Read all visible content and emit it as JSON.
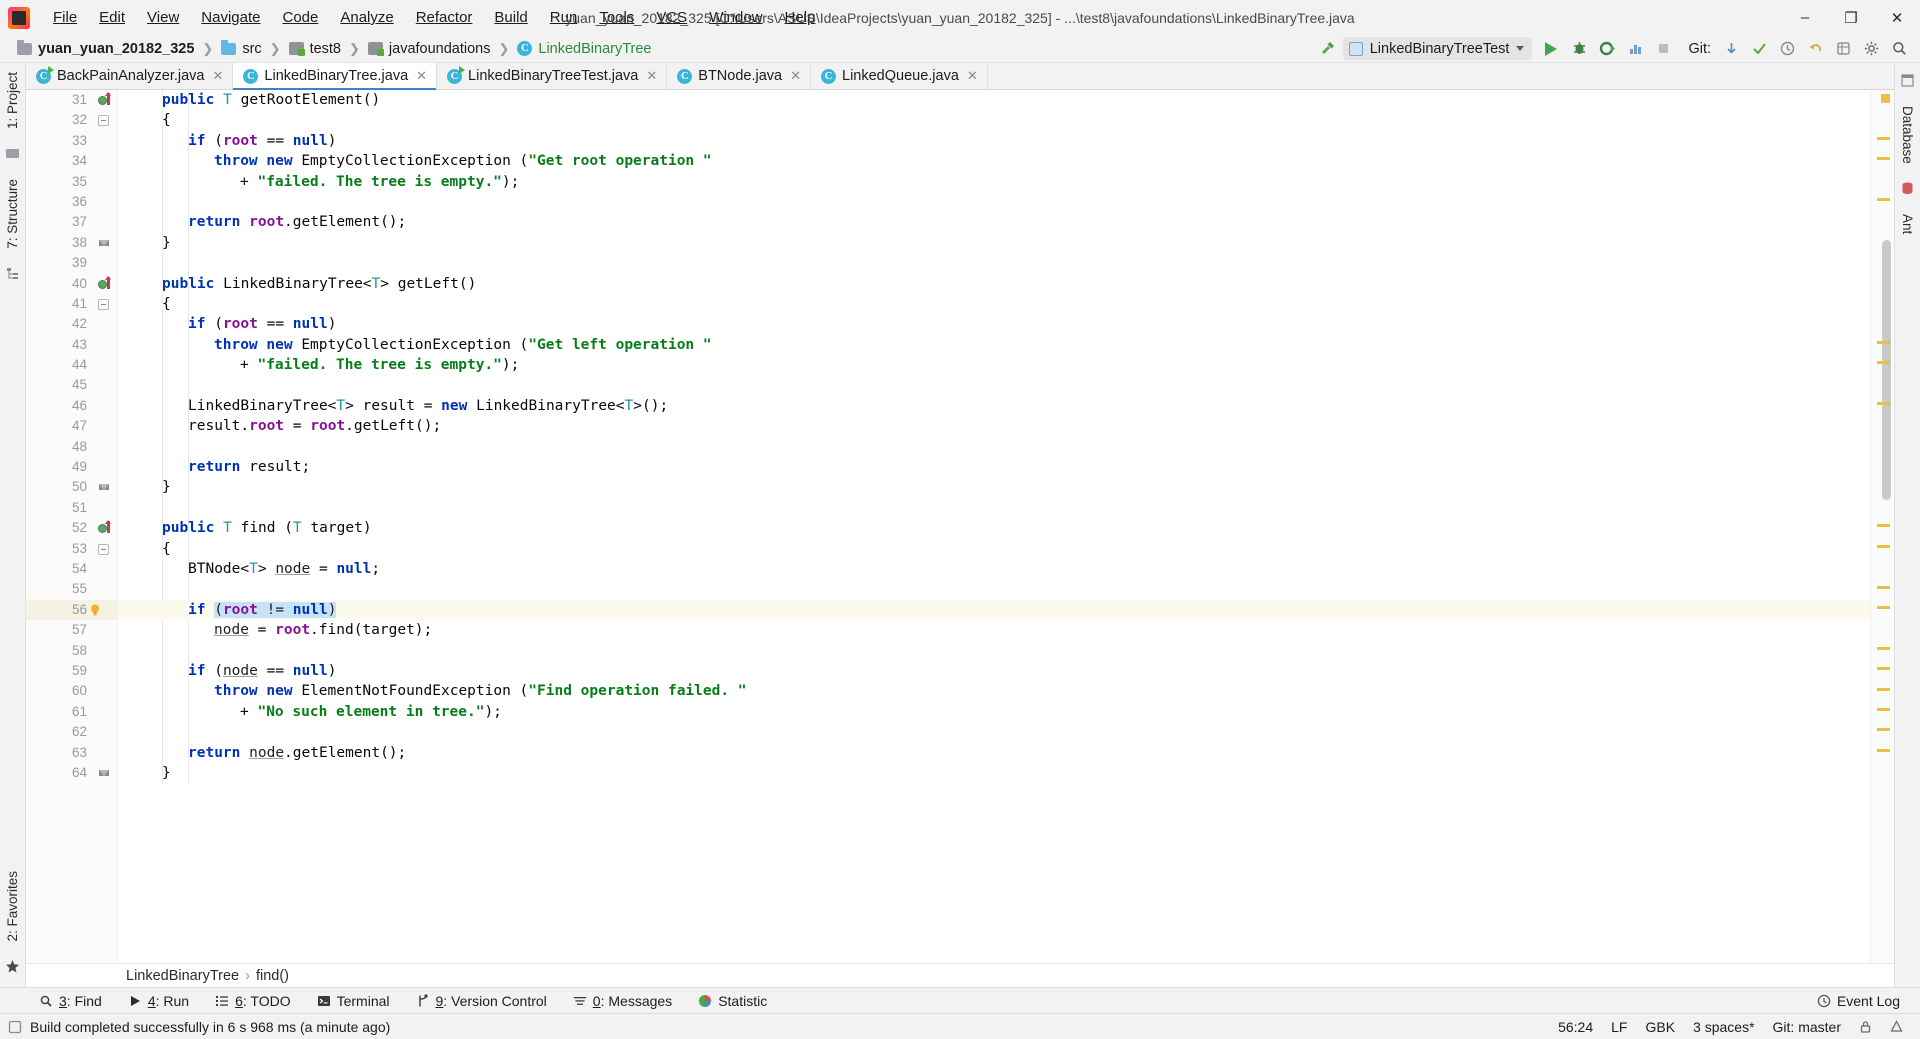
{
  "window": {
    "title": "yuan_yuan_20182_325 [C:\\Users\\ASUS\\IdeaProjects\\yuan_yuan_20182_325] - ...\\test8\\javafoundations\\LinkedBinaryTree.java",
    "minimize_label": "–",
    "maximize_label": "❐",
    "close_label": "✕",
    "logo_name": "intellij-idea-logo"
  },
  "menu": [
    {
      "label": "File"
    },
    {
      "label": "Edit"
    },
    {
      "label": "View"
    },
    {
      "label": "Navigate"
    },
    {
      "label": "Code"
    },
    {
      "label": "Analyze"
    },
    {
      "label": "Refactor"
    },
    {
      "label": "Build"
    },
    {
      "label": "Run"
    },
    {
      "label": "Tools"
    },
    {
      "label": "VCS"
    },
    {
      "label": "Window"
    },
    {
      "label": "Help"
    }
  ],
  "breadcrumbs": [
    {
      "label": "yuan_yuan_20182_325",
      "icon": "project-icon"
    },
    {
      "label": "src",
      "icon": "source-folder-icon"
    },
    {
      "label": "test8",
      "icon": "package-icon"
    },
    {
      "label": "javafoundations",
      "icon": "package-icon"
    },
    {
      "label": "LinkedBinaryTree",
      "icon": "class-icon"
    }
  ],
  "toolbar": {
    "build_icon": "hammer-icon",
    "run_config": "LinkedBinaryTreeTest",
    "run_icon": "run-icon",
    "debug_icon": "debug-icon",
    "run_coverage_icon": "run-with-coverage-icon",
    "profile_icon": "profiler-icon",
    "stop_icon": "stop-icon",
    "git_label": "Git:",
    "git_update_icon": "update-project-icon",
    "git_commit_icon": "commit-icon",
    "git_history_icon": "history-icon",
    "undo_icon": "undo-icon",
    "project_structure_icon": "project-structure-icon",
    "settings_icon": "settings-icon",
    "search_icon": "search-everywhere-icon"
  },
  "left_strip": [
    {
      "label": "1: Project",
      "name": "tool-button-project"
    },
    {
      "label": "7: Structure",
      "name": "tool-button-structure"
    }
  ],
  "left_strip_bottom": [
    {
      "label": "2: Favorites",
      "name": "tool-button-favorites"
    }
  ],
  "right_strip": [
    {
      "label": "Database",
      "name": "tool-button-database"
    },
    {
      "label": "Ant",
      "name": "tool-button-ant"
    }
  ],
  "tabs": [
    {
      "label": "BackPainAnalyzer.java",
      "active": false,
      "runnable": true
    },
    {
      "label": "LinkedBinaryTree.java",
      "active": true,
      "runnable": false
    },
    {
      "label": "LinkedBinaryTreeTest.java",
      "active": false,
      "runnable": true
    },
    {
      "label": "BTNode.java",
      "active": false,
      "runnable": false
    },
    {
      "label": "LinkedQueue.java",
      "active": false,
      "runnable": false
    }
  ],
  "tab_close_label": "✕",
  "editor": {
    "first_line": 31,
    "highlighted_line": 56,
    "lines": [
      {
        "n": 31,
        "indent": 1,
        "gutter": "run",
        "html": "<span class=\"kw\">public</span> <span class=\"ty\">T</span> <span class=\"pln\">getRootElement()</span>"
      },
      {
        "n": 32,
        "indent": 1,
        "gutter": "fold",
        "html": "<span class=\"pln\">{</span>"
      },
      {
        "n": 33,
        "indent": 2,
        "gutter": "",
        "html": "<span class=\"kw\">if</span> <span class=\"pln\">(</span><span class=\"fld\">root</span> <span class=\"pln\">==</span> <span class=\"kw\">null</span><span class=\"pln\">)</span>"
      },
      {
        "n": 34,
        "indent": 3,
        "gutter": "",
        "html": "<span class=\"kw\">throw new</span> <span class=\"pln\">EmptyCollectionException (</span><span class=\"str\">\"Get root operation \"</span>"
      },
      {
        "n": 35,
        "indent": 4,
        "gutter": "",
        "html": "<span class=\"pln\">+ </span><span class=\"str\">\"failed. The tree is empty.\"</span><span class=\"pln\">);</span>"
      },
      {
        "n": 36,
        "indent": 2,
        "gutter": "",
        "html": ""
      },
      {
        "n": 37,
        "indent": 2,
        "gutter": "",
        "html": "<span class=\"kw\">return</span> <span class=\"fld\">root</span><span class=\"pln\">.getElement();</span>"
      },
      {
        "n": 38,
        "indent": 1,
        "gutter": "foldend",
        "html": "<span class=\"pln\">}</span>"
      },
      {
        "n": 39,
        "indent": 0,
        "gutter": "",
        "html": ""
      },
      {
        "n": 40,
        "indent": 1,
        "gutter": "run",
        "html": "<span class=\"kw\">public</span> <span class=\"pln\">LinkedBinaryTree&lt;</span><span class=\"ty\">T</span><span class=\"pln\">&gt; getLeft()</span>"
      },
      {
        "n": 41,
        "indent": 1,
        "gutter": "fold",
        "html": "<span class=\"pln\">{</span>"
      },
      {
        "n": 42,
        "indent": 2,
        "gutter": "",
        "html": "<span class=\"kw\">if</span> <span class=\"pln\">(</span><span class=\"fld\">root</span> <span class=\"pln\">==</span> <span class=\"kw\">null</span><span class=\"pln\">)</span>"
      },
      {
        "n": 43,
        "indent": 3,
        "gutter": "",
        "html": "<span class=\"kw\">throw new</span> <span class=\"pln\">EmptyCollectionException (</span><span class=\"str\">\"Get left operation \"</span>"
      },
      {
        "n": 44,
        "indent": 4,
        "gutter": "",
        "html": "<span class=\"pln\">+ </span><span class=\"str\">\"failed. The tree is empty.\"</span><span class=\"pln\">);</span>"
      },
      {
        "n": 45,
        "indent": 2,
        "gutter": "",
        "html": ""
      },
      {
        "n": 46,
        "indent": 2,
        "gutter": "",
        "html": "<span class=\"pln\">LinkedBinaryTree&lt;</span><span class=\"ty\">T</span><span class=\"pln\">&gt; result = </span><span class=\"kw\">new</span> <span class=\"pln\">LinkedBinaryTree&lt;</span><span class=\"ty\">T</span><span class=\"pln\">&gt;();</span>"
      },
      {
        "n": 47,
        "indent": 2,
        "gutter": "",
        "html": "<span class=\"pln\">result.</span><span class=\"fld\">root</span><span class=\"pln\"> = </span><span class=\"fld\">root</span><span class=\"pln\">.getLeft();</span>"
      },
      {
        "n": 48,
        "indent": 2,
        "gutter": "",
        "html": ""
      },
      {
        "n": 49,
        "indent": 2,
        "gutter": "",
        "html": "<span class=\"kw\">return</span> <span class=\"pln\">result;</span>"
      },
      {
        "n": 50,
        "indent": 1,
        "gutter": "foldend",
        "html": "<span class=\"pln\">}</span>"
      },
      {
        "n": 51,
        "indent": 0,
        "gutter": "",
        "html": ""
      },
      {
        "n": 52,
        "indent": 1,
        "gutter": "run",
        "html": "<span class=\"kw\">public</span> <span class=\"ty\">T</span> <span class=\"pln\">find (</span><span class=\"ty\">T</span><span class=\"pln\"> target)</span>"
      },
      {
        "n": 53,
        "indent": 1,
        "gutter": "fold",
        "html": "<span class=\"pln\">{</span>"
      },
      {
        "n": 54,
        "indent": 2,
        "gutter": "",
        "html": "<span class=\"pln\">BTNode&lt;</span><span class=\"ty\">T</span><span class=\"pln\">&gt; </span><span class=\"und\">node</span><span class=\"pln\"> = </span><span class=\"kw\">null</span><span class=\"pln\">;</span>"
      },
      {
        "n": 55,
        "indent": 2,
        "gutter": "",
        "html": ""
      },
      {
        "n": 56,
        "indent": 2,
        "gutter": "bulb",
        "html": "<span class=\"kw\">if</span> <span class=\"selp\">(</span><span class=\"fld selp\">root</span><span class=\"selp\"> != </span><span class=\"kw selp\">null</span><span class=\"selp\">)</span>"
      },
      {
        "n": 57,
        "indent": 3,
        "gutter": "",
        "html": "<span class=\"und\">node</span><span class=\"pln\"> = </span><span class=\"fld\">root</span><span class=\"pln\">.find(target);</span>"
      },
      {
        "n": 58,
        "indent": 2,
        "gutter": "",
        "html": ""
      },
      {
        "n": 59,
        "indent": 2,
        "gutter": "",
        "html": "<span class=\"kw\">if</span> <span class=\"pln\">(</span><span class=\"und\">node</span><span class=\"pln\"> == </span><span class=\"kw\">null</span><span class=\"pln\">)</span>"
      },
      {
        "n": 60,
        "indent": 3,
        "gutter": "",
        "html": "<span class=\"kw\">throw new</span> <span class=\"pln\">ElementNotFoundException (</span><span class=\"str\">\"Find operation failed. \"</span>"
      },
      {
        "n": 61,
        "indent": 4,
        "gutter": "",
        "html": "<span class=\"pln\">+ </span><span class=\"str\">\"No such element in tree.\"</span><span class=\"pln\">);</span>"
      },
      {
        "n": 62,
        "indent": 2,
        "gutter": "",
        "html": ""
      },
      {
        "n": 63,
        "indent": 2,
        "gutter": "",
        "html": "<span class=\"kw\">return</span> <span class=\"und\">node</span><span class=\"pln\">.getElement();</span>"
      },
      {
        "n": 64,
        "indent": 1,
        "gutter": "foldend",
        "html": "<span class=\"pln\">}</span>"
      }
    ],
    "crumbs": [
      "LinkedBinaryTree",
      "find()"
    ],
    "crumb_sep": "›"
  },
  "bottom_tools": [
    {
      "num": "3",
      "label": ": Find",
      "icon": "search-icon",
      "name": "tool-window-find"
    },
    {
      "num": "4",
      "label": ": Run",
      "icon": "run-icon",
      "name": "tool-window-run"
    },
    {
      "num": "6",
      "label": ": TODO",
      "icon": "todo-icon",
      "name": "tool-window-todo"
    },
    {
      "num": "",
      "label": "Terminal",
      "icon": "terminal-icon",
      "name": "tool-window-terminal"
    },
    {
      "num": "9",
      "label": ": Version Control",
      "icon": "branch-icon",
      "name": "tool-window-version-control"
    },
    {
      "num": "0",
      "label": ": Messages",
      "icon": "messages-icon",
      "name": "tool-window-messages"
    },
    {
      "num": "",
      "label": "Statistic",
      "icon": "statistic-icon",
      "name": "tool-window-statistic"
    }
  ],
  "event_log": {
    "label": "Event Log",
    "icon": "event-log-icon"
  },
  "status": {
    "message": "Build completed successfully in 6 s 968 ms (a minute ago)",
    "message_icon": "build-icon",
    "caret": "56:24",
    "line_separator": "LF",
    "encoding": "GBK",
    "indent": "3 spaces*",
    "branch": "Git: master",
    "lock_icon": "read-only-icon",
    "inspect_icon": "inspection-icon"
  },
  "colors": {
    "accent": "#3c83c8",
    "keyword": "#0033b3",
    "string": "#067d17",
    "field": "#871094",
    "type": "#20999d",
    "highlight_row": "#fcfaed",
    "selection": "#c6e2f7",
    "marker": "#e8c045",
    "green": "#2a8a3e"
  }
}
